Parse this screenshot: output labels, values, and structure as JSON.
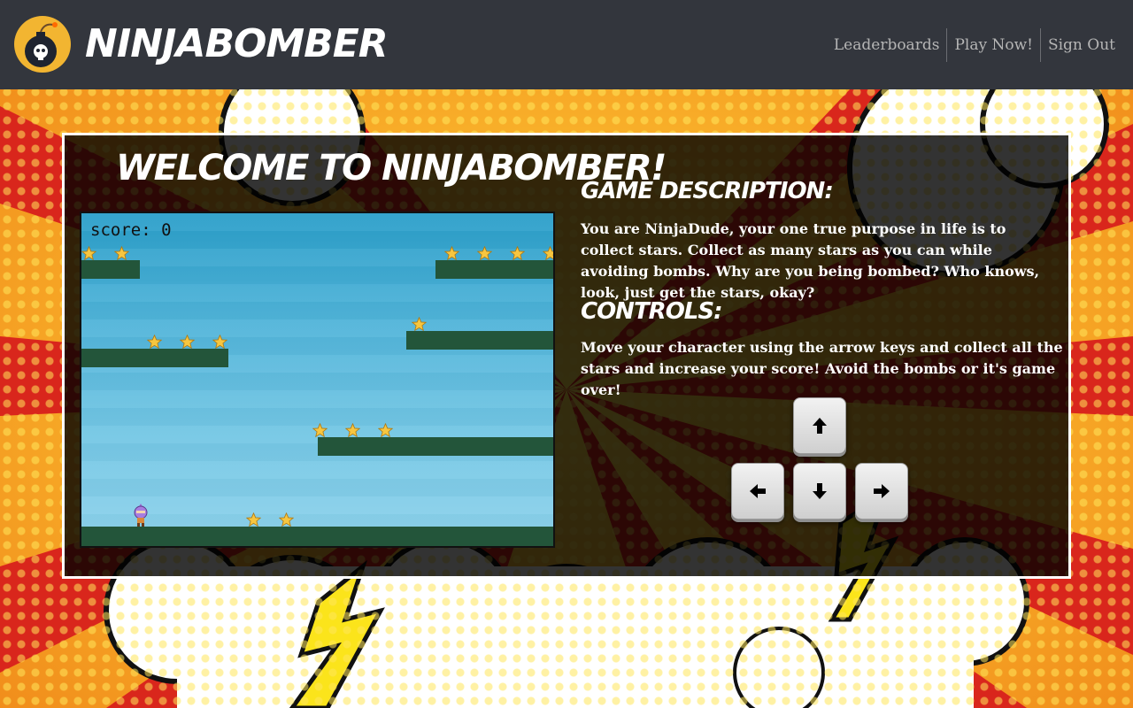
{
  "header": {
    "brand": "NINJABOMBER",
    "logo_icon": "bomb-skull-icon",
    "nav": [
      {
        "label": "Leaderboards"
      },
      {
        "label": "Play Now!"
      },
      {
        "label": "Sign Out"
      }
    ]
  },
  "main": {
    "welcome_title": "WELCOME TO NINJABOMBER!",
    "game": {
      "score_label": "score: 0",
      "score": 0
    },
    "description_title": "GAME DESCRIPTION:",
    "description_text": "You are NinjaDude, your one true purpose in life is to collect stars. Collect as many stars as you can while avoiding bombs. Why are you being bombed? Who knows, look, just get the stars, okay?",
    "controls_title": "CONTROLS:",
    "controls_text": "Move your character using the arrow keys and collect all the stars and increase your score! Avoid the bombs or it's game over!",
    "keys": [
      {
        "icon": "arrow-up-icon"
      },
      {
        "icon": "arrow-left-icon"
      },
      {
        "icon": "arrow-down-icon"
      },
      {
        "icon": "arrow-right-icon"
      }
    ]
  },
  "colors": {
    "header_bg": "#33363d",
    "panel_bg": "#1c1c1c",
    "platform": "#23553a",
    "sky": "#4db2d8",
    "logo_bg": "#f2b531",
    "nav_text": "#b5b5b5"
  }
}
